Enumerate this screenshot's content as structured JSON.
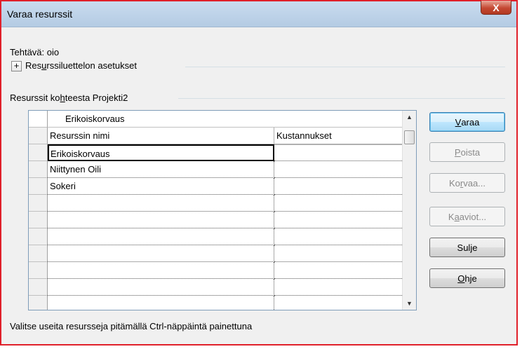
{
  "window": {
    "title": "Varaa resurssit",
    "close_label": "X"
  },
  "task": {
    "label": "Tehtävä: oio"
  },
  "options": {
    "expander_symbol": "+",
    "label_pre": "Res",
    "label_mnemonic": "u",
    "label_post": "rssiluettelon asetukset"
  },
  "resources_section": {
    "label_pre": "Resurssit ko",
    "label_mnemonic": "h",
    "label_post": "teesta Projekti2"
  },
  "grid": {
    "edit_value": "Erikoiskorvaus",
    "columns": [
      "Resurssin nimi",
      "Kustannukset"
    ],
    "rows": [
      {
        "name": "Erikoiskorvaus",
        "cost": ""
      },
      {
        "name": "Niittynen Oili",
        "cost": ""
      },
      {
        "name": "Sokeri",
        "cost": ""
      },
      {
        "name": "",
        "cost": ""
      },
      {
        "name": "",
        "cost": ""
      },
      {
        "name": "",
        "cost": ""
      },
      {
        "name": "",
        "cost": ""
      },
      {
        "name": "",
        "cost": ""
      },
      {
        "name": "",
        "cost": ""
      }
    ]
  },
  "buttons": {
    "assign": {
      "pre": "",
      "mn": "V",
      "post": "araa"
    },
    "remove": {
      "pre": "",
      "mn": "P",
      "post": "oista"
    },
    "replace": {
      "pre": "Ko",
      "mn": "r",
      "post": "vaa..."
    },
    "graphs": {
      "pre": "K",
      "mn": "a",
      "post": "aviot..."
    },
    "close": {
      "pre": "Sulje",
      "mn": "",
      "post": ""
    },
    "help": {
      "pre": "",
      "mn": "O",
      "post": "hje"
    }
  },
  "footer": {
    "hint": "Valitse useita resursseja pitämällä Ctrl-näppäintä painettuna"
  }
}
